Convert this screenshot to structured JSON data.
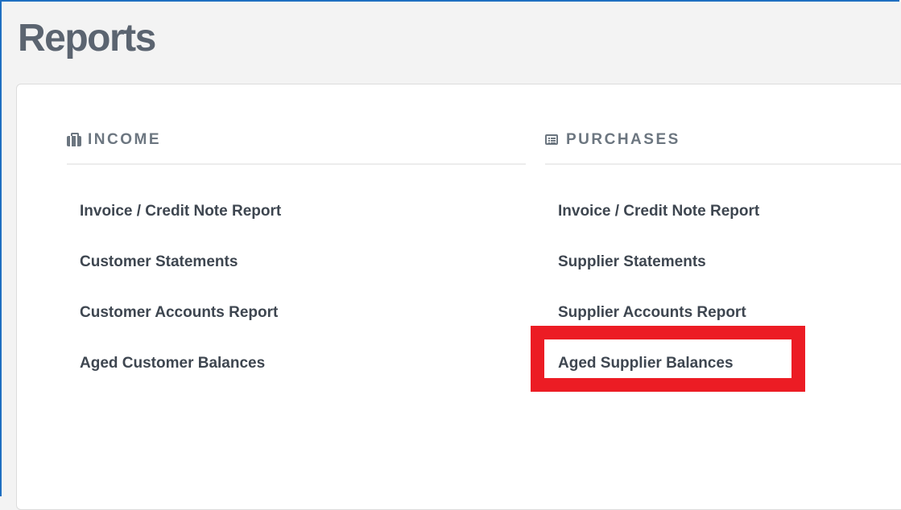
{
  "page": {
    "title": "Reports"
  },
  "income": {
    "icon": "briefcase-icon",
    "title": "INCOME",
    "items": [
      {
        "label": "Invoice / Credit Note Report"
      },
      {
        "label": "Customer Statements"
      },
      {
        "label": "Customer Accounts Report"
      },
      {
        "label": "Aged Customer Balances"
      }
    ]
  },
  "purchases": {
    "icon": "list-alt-icon",
    "title": "PURCHASES",
    "items": [
      {
        "label": "Invoice / Credit Note Report"
      },
      {
        "label": "Supplier Statements"
      },
      {
        "label": "Supplier Accounts Report"
      },
      {
        "label": "Aged Supplier Balances"
      }
    ]
  },
  "annotation": {
    "highlight_color": "#ec1c24",
    "highlighted_item": "Aged Supplier Balances"
  }
}
